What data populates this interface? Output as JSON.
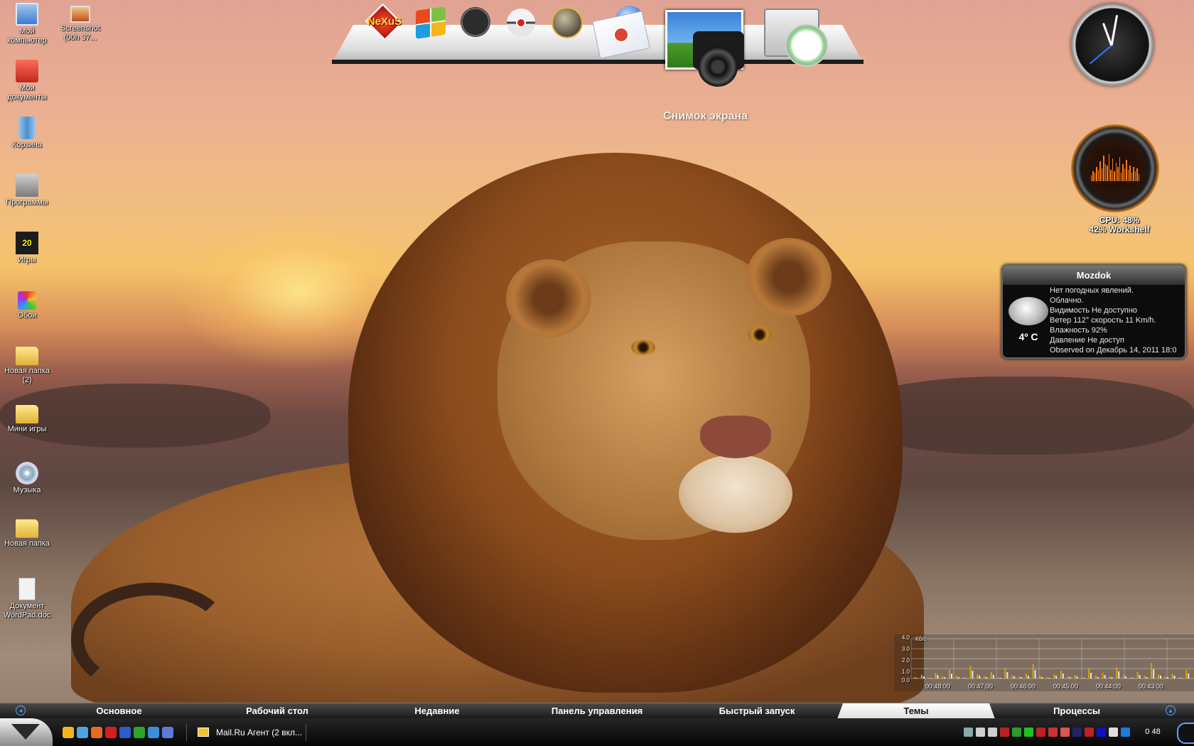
{
  "desktop_icons": [
    {
      "id": "my-computer",
      "label": "Мой\nкомпьютер"
    },
    {
      "id": "screenshot",
      "label": "Screenshot\n(00h 37..."
    },
    {
      "id": "my-documents",
      "label": "Мои\nдокументы"
    },
    {
      "id": "recycle-bin",
      "label": "Корзина"
    },
    {
      "id": "programs",
      "label": "Программы"
    },
    {
      "id": "games",
      "label": "Игры"
    },
    {
      "id": "wallpapers",
      "label": "Обои"
    },
    {
      "id": "new-folder-2",
      "label": "Новая папка\n(2)"
    },
    {
      "id": "mini-games",
      "label": "Мини игры"
    },
    {
      "id": "music",
      "label": "Музыка"
    },
    {
      "id": "new-folder",
      "label": "Новая папка"
    },
    {
      "id": "wordpad-doc",
      "label": "Документ\nWordPad.doc"
    }
  ],
  "dock": {
    "nexus_label": "NeXuS",
    "hover_label": "Снимок экрана",
    "items": [
      "nexus-logo",
      "windows-logo",
      "clock",
      "pokeball",
      "globe",
      "mail",
      "screenshot-camera",
      "time-sync"
    ]
  },
  "cpu_gadget": {
    "line1": "CPU: 48%",
    "line2": "42% Workshelf",
    "accent": "#ff7a1a",
    "meter_levels": [
      0.2,
      0.35,
      0.3,
      0.5,
      0.4,
      0.7,
      0.45,
      0.9,
      0.6,
      0.55,
      0.95,
      0.4,
      0.8,
      0.35,
      0.65,
      0.5,
      0.85,
      0.3,
      0.6,
      0.45,
      0.75,
      0.4,
      0.55,
      0.3,
      0.5,
      0.35,
      0.45,
      0.25
    ]
  },
  "weather": {
    "city": "Mozdok",
    "temperature": "4º C",
    "lines": [
      "Нет погодных явлений.",
      "Облачно.",
      "Видимость Не доступно",
      "Ветер 112° скорость 11 Km/h.",
      "Влажность 92%",
      "Давление Не доступ",
      "Observed on Декабрь 14, 2011 18:0"
    ]
  },
  "network_meter": {
    "unit": "Кб/с",
    "y_ticks": [
      "4.0",
      "3.0",
      "2.0",
      "1.0",
      "0.0"
    ],
    "x_ticks": [
      "00:48:00",
      "00:47:00",
      "00:46:00",
      "00:45:00",
      "00:44:00",
      "00:43:00"
    ],
    "series_colors": {
      "download": "#d9a400",
      "upload": "#e8e8e8"
    }
  },
  "category_bar": {
    "tabs": [
      "Основное",
      "Рабочий стол",
      "Недавние",
      "Панель управления",
      "Быстрый запуск",
      "Темы",
      "Процессы"
    ],
    "active": "Темы"
  },
  "taskbar": {
    "task_label": "Mail.Ru Агент (2 вкл...",
    "clock": "0 48",
    "quick_launch_colors": [
      "#f5b61a",
      "#4fa3e0",
      "#e66b1c",
      "#d61f1f",
      "#2e5cc9",
      "#2aa52a",
      "#3a8fdc",
      "#5b7bd6"
    ],
    "tray_colors": [
      "#8aa",
      "#cfcfcf",
      "#cfcfcf",
      "#b22",
      "#2a9a2a",
      "#1ec41e",
      "#b22",
      "#c33",
      "#d55",
      "#226",
      "#b22",
      "#11c",
      "#ddd",
      "#27d"
    ]
  }
}
